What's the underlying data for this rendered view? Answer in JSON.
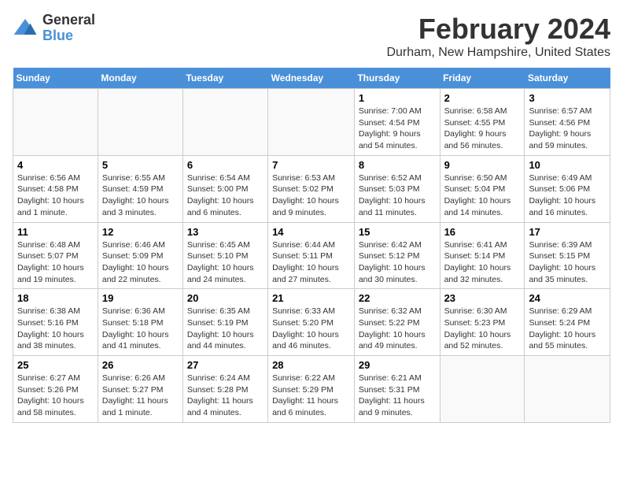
{
  "logo": {
    "general": "General",
    "blue": "Blue"
  },
  "title": "February 2024",
  "location": "Durham, New Hampshire, United States",
  "days_of_week": [
    "Sunday",
    "Monday",
    "Tuesday",
    "Wednesday",
    "Thursday",
    "Friday",
    "Saturday"
  ],
  "weeks": [
    [
      {
        "day": "",
        "details": ""
      },
      {
        "day": "",
        "details": ""
      },
      {
        "day": "",
        "details": ""
      },
      {
        "day": "",
        "details": ""
      },
      {
        "day": "1",
        "details": "Sunrise: 7:00 AM\nSunset: 4:54 PM\nDaylight: 9 hours\nand 54 minutes."
      },
      {
        "day": "2",
        "details": "Sunrise: 6:58 AM\nSunset: 4:55 PM\nDaylight: 9 hours\nand 56 minutes."
      },
      {
        "day": "3",
        "details": "Sunrise: 6:57 AM\nSunset: 4:56 PM\nDaylight: 9 hours\nand 59 minutes."
      }
    ],
    [
      {
        "day": "4",
        "details": "Sunrise: 6:56 AM\nSunset: 4:58 PM\nDaylight: 10 hours\nand 1 minute."
      },
      {
        "day": "5",
        "details": "Sunrise: 6:55 AM\nSunset: 4:59 PM\nDaylight: 10 hours\nand 3 minutes."
      },
      {
        "day": "6",
        "details": "Sunrise: 6:54 AM\nSunset: 5:00 PM\nDaylight: 10 hours\nand 6 minutes."
      },
      {
        "day": "7",
        "details": "Sunrise: 6:53 AM\nSunset: 5:02 PM\nDaylight: 10 hours\nand 9 minutes."
      },
      {
        "day": "8",
        "details": "Sunrise: 6:52 AM\nSunset: 5:03 PM\nDaylight: 10 hours\nand 11 minutes."
      },
      {
        "day": "9",
        "details": "Sunrise: 6:50 AM\nSunset: 5:04 PM\nDaylight: 10 hours\nand 14 minutes."
      },
      {
        "day": "10",
        "details": "Sunrise: 6:49 AM\nSunset: 5:06 PM\nDaylight: 10 hours\nand 16 minutes."
      }
    ],
    [
      {
        "day": "11",
        "details": "Sunrise: 6:48 AM\nSunset: 5:07 PM\nDaylight: 10 hours\nand 19 minutes."
      },
      {
        "day": "12",
        "details": "Sunrise: 6:46 AM\nSunset: 5:09 PM\nDaylight: 10 hours\nand 22 minutes."
      },
      {
        "day": "13",
        "details": "Sunrise: 6:45 AM\nSunset: 5:10 PM\nDaylight: 10 hours\nand 24 minutes."
      },
      {
        "day": "14",
        "details": "Sunrise: 6:44 AM\nSunset: 5:11 PM\nDaylight: 10 hours\nand 27 minutes."
      },
      {
        "day": "15",
        "details": "Sunrise: 6:42 AM\nSunset: 5:12 PM\nDaylight: 10 hours\nand 30 minutes."
      },
      {
        "day": "16",
        "details": "Sunrise: 6:41 AM\nSunset: 5:14 PM\nDaylight: 10 hours\nand 32 minutes."
      },
      {
        "day": "17",
        "details": "Sunrise: 6:39 AM\nSunset: 5:15 PM\nDaylight: 10 hours\nand 35 minutes."
      }
    ],
    [
      {
        "day": "18",
        "details": "Sunrise: 6:38 AM\nSunset: 5:16 PM\nDaylight: 10 hours\nand 38 minutes."
      },
      {
        "day": "19",
        "details": "Sunrise: 6:36 AM\nSunset: 5:18 PM\nDaylight: 10 hours\nand 41 minutes."
      },
      {
        "day": "20",
        "details": "Sunrise: 6:35 AM\nSunset: 5:19 PM\nDaylight: 10 hours\nand 44 minutes."
      },
      {
        "day": "21",
        "details": "Sunrise: 6:33 AM\nSunset: 5:20 PM\nDaylight: 10 hours\nand 46 minutes."
      },
      {
        "day": "22",
        "details": "Sunrise: 6:32 AM\nSunset: 5:22 PM\nDaylight: 10 hours\nand 49 minutes."
      },
      {
        "day": "23",
        "details": "Sunrise: 6:30 AM\nSunset: 5:23 PM\nDaylight: 10 hours\nand 52 minutes."
      },
      {
        "day": "24",
        "details": "Sunrise: 6:29 AM\nSunset: 5:24 PM\nDaylight: 10 hours\nand 55 minutes."
      }
    ],
    [
      {
        "day": "25",
        "details": "Sunrise: 6:27 AM\nSunset: 5:26 PM\nDaylight: 10 hours\nand 58 minutes."
      },
      {
        "day": "26",
        "details": "Sunrise: 6:26 AM\nSunset: 5:27 PM\nDaylight: 11 hours\nand 1 minute."
      },
      {
        "day": "27",
        "details": "Sunrise: 6:24 AM\nSunset: 5:28 PM\nDaylight: 11 hours\nand 4 minutes."
      },
      {
        "day": "28",
        "details": "Sunrise: 6:22 AM\nSunset: 5:29 PM\nDaylight: 11 hours\nand 6 minutes."
      },
      {
        "day": "29",
        "details": "Sunrise: 6:21 AM\nSunset: 5:31 PM\nDaylight: 11 hours\nand 9 minutes."
      },
      {
        "day": "",
        "details": ""
      },
      {
        "day": "",
        "details": ""
      }
    ]
  ]
}
